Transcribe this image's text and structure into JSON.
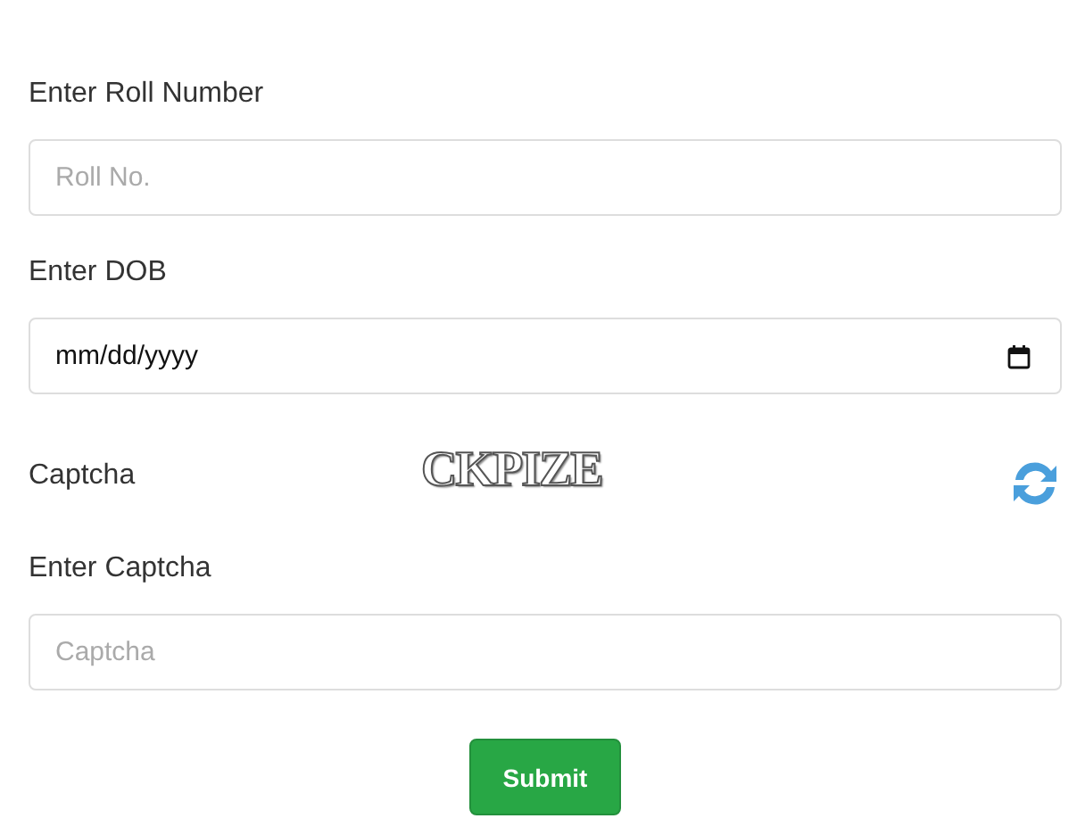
{
  "fields": [
    {
      "kind": "text",
      "label": "Enter Roll Number",
      "placeholder": "Roll No."
    },
    {
      "kind": "date",
      "label": "Enter DOB",
      "value": "mm/dd/yyyy"
    },
    {
      "kind": "captcha",
      "label": "Captcha",
      "captcha_text": "CKPIZE"
    },
    {
      "kind": "text",
      "label": "Enter Captcha",
      "placeholder": "Captcha"
    }
  ],
  "submit": "Submit"
}
